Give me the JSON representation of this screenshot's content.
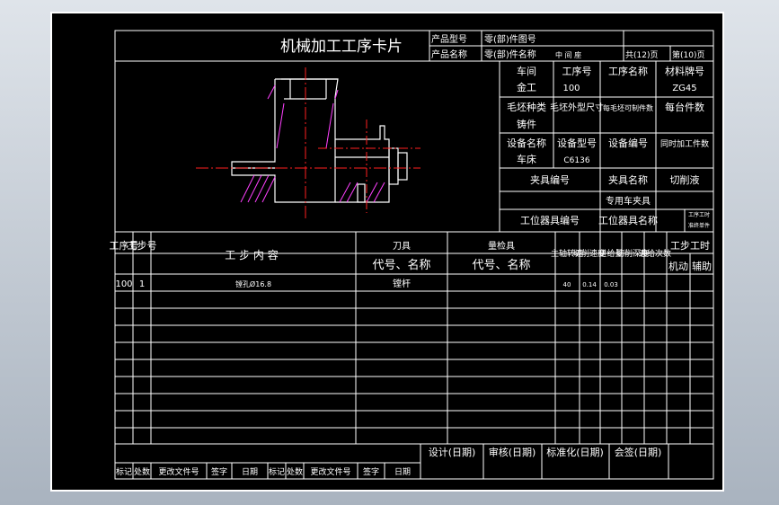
{
  "card": {
    "title": "机械加工工序卡片",
    "product_model_label": "产品型号",
    "part_drawing_no_label": "零(部)件图号",
    "product_name_label": "产品名称",
    "part_name_label": "零(部)件名称",
    "part_name_value": "中 间 座",
    "sheets_total": "共(12)页",
    "sheet_no": "第(10)页"
  },
  "info": {
    "workshop_label": "车间",
    "workshop_value": "金工",
    "process_no_label": "工序号",
    "process_no_value": "100",
    "process_name_label": "工序名称",
    "material_label": "材料牌号",
    "material_value": "ZG45",
    "blank_type_label": "毛坯种类",
    "blank_type_value": "铸件",
    "blank_size_label": "毛坯外型尺寸",
    "per_blank_label": "每毛坯可制件数",
    "per_unit_label": "每台件数",
    "equipment_name_label": "设备名称",
    "equipment_name_value": "车床",
    "equipment_model_label": "设备型号",
    "equipment_model_value": "C6136",
    "equipment_no_label": "设备编号",
    "simultaneous_label": "同时加工件数",
    "fixture_no_label": "夹具编号",
    "fixture_name_label": "夹具名称",
    "fixture_name_value": "专用车夹具",
    "coolant_label": "切削液",
    "station_tool_no_label": "工位器具编号",
    "station_tool_name_label": "工位器具名称",
    "process_hours_label": "工序工时",
    "hours_sub_label": "准终单件"
  },
  "steps_header": {
    "process_no": "工序号",
    "step_no": "工步号",
    "step_content": "工 步 内 容",
    "tool": "刀具",
    "tool_code_name": "代号、名称",
    "gauge": "量检具",
    "gauge_code_name": "代号、名称",
    "spindle_speed": "主轴转速",
    "cutting_speed": "切削速度",
    "feed": "进给量",
    "depth": "切削深度",
    "feed_times": "进给次数",
    "step_hours": "工步工时",
    "machine": "机动",
    "auxiliary": "辅助"
  },
  "steps": [
    {
      "process_no": "100",
      "step_no": "1",
      "content": "镗孔Ø16.8",
      "tool": "镗杆",
      "gauge": "",
      "spindle_speed": "40",
      "cutting_speed": "0.14",
      "feed": "0.03"
    }
  ],
  "signoff": {
    "design": "设计(日期)",
    "review": "审核(日期)",
    "standardize": "标准化(日期)",
    "countersign": "会签(日期)",
    "mark": "标记",
    "places": "处数",
    "change_doc_no": "更改文件号",
    "signature": "签字",
    "date": "日期"
  }
}
